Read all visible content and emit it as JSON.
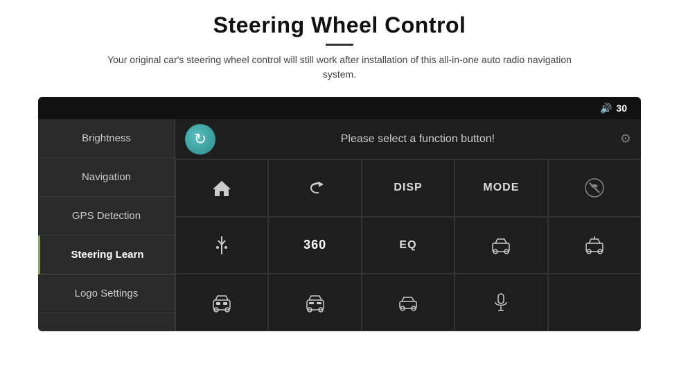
{
  "header": {
    "title": "Steering Wheel Control",
    "subtitle": "Your original car's steering wheel control will still work after installation of this all-in-one auto radio navigation system."
  },
  "status_bar": {
    "volume_label": "30"
  },
  "sidebar": {
    "items": [
      {
        "id": "brightness",
        "label": "Brightness",
        "active": false
      },
      {
        "id": "navigation",
        "label": "Navigation",
        "active": false
      },
      {
        "id": "gps-detection",
        "label": "GPS Detection",
        "active": false
      },
      {
        "id": "steering-learn",
        "label": "Steering Learn",
        "active": true
      },
      {
        "id": "logo-settings",
        "label": "Logo Settings",
        "active": false
      }
    ]
  },
  "content": {
    "refresh_icon": "↻",
    "prompt": "Please select a function button!",
    "buttons": [
      {
        "id": "home",
        "type": "icon-home",
        "label": ""
      },
      {
        "id": "back",
        "type": "icon-back",
        "label": ""
      },
      {
        "id": "disp",
        "type": "text",
        "label": "DISP"
      },
      {
        "id": "mode",
        "type": "text",
        "label": "MODE"
      },
      {
        "id": "phone-off",
        "type": "icon-phone",
        "label": ""
      },
      {
        "id": "antenna",
        "type": "icon-antenna",
        "label": ""
      },
      {
        "id": "360",
        "type": "text",
        "label": "360"
      },
      {
        "id": "eq",
        "type": "text",
        "label": "EQ"
      },
      {
        "id": "car1",
        "type": "icon-car1",
        "label": ""
      },
      {
        "id": "car2",
        "type": "icon-car2",
        "label": ""
      },
      {
        "id": "car3",
        "type": "icon-car3",
        "label": ""
      },
      {
        "id": "car4",
        "type": "icon-car4",
        "label": ""
      },
      {
        "id": "car5",
        "type": "icon-car5",
        "label": ""
      },
      {
        "id": "mic",
        "type": "icon-mic",
        "label": ""
      },
      {
        "id": "empty",
        "type": "empty",
        "label": ""
      }
    ]
  }
}
